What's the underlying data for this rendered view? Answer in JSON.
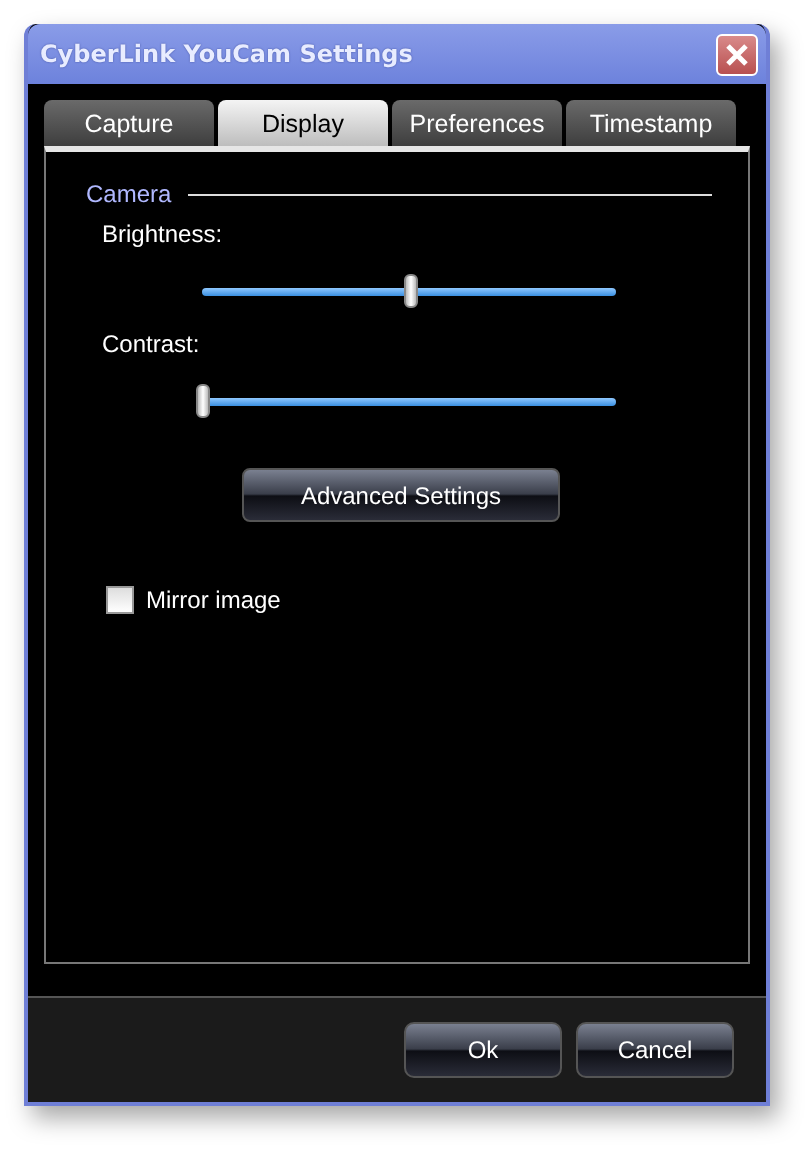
{
  "window": {
    "title": "CyberLink YouCam Settings"
  },
  "tabs": [
    {
      "label": "Capture",
      "selected": false
    },
    {
      "label": "Display",
      "selected": true
    },
    {
      "label": "Preferences",
      "selected": false
    },
    {
      "label": "Timestamp",
      "selected": false
    }
  ],
  "group": {
    "title": "Camera"
  },
  "sliders": [
    {
      "label": "Brightness:",
      "level": 0.5
    },
    {
      "label": "Contrast:",
      "level": 0
    }
  ],
  "advanced_button": "Advanced Settings",
  "mirror_image": {
    "label": "Mirror image",
    "checked": false
  },
  "buttons": [
    "Ok",
    "Cancel"
  ]
}
